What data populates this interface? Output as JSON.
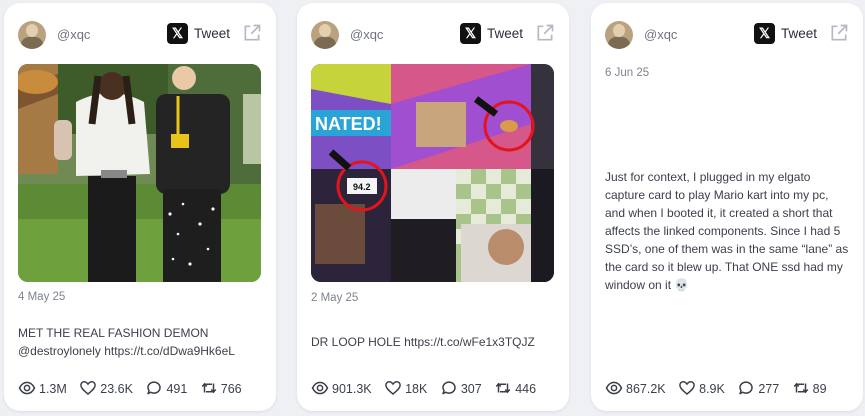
{
  "cards": [
    {
      "handle": "@xqc",
      "tweet_label": "Tweet",
      "date": "4 May 25",
      "text": "MET THE REAL FASHION DEMON @destroylonely https://t.co/dDwa9Hk6eL",
      "views": "1.3M",
      "likes": "23.6K",
      "replies": "491",
      "retweets": "766"
    },
    {
      "handle": "@xqc",
      "tweet_label": "Tweet",
      "date": "2 May 25",
      "text": "DR LOOP HOLE https://t.co/wFe1x3TQJZ",
      "media_text": {
        "banner": "NATED!",
        "score": "94.2"
      },
      "views": "901.3K",
      "likes": "18K",
      "replies": "307",
      "retweets": "446"
    },
    {
      "handle": "@xqc",
      "tweet_label": "Tweet",
      "date": "6 Jun 25",
      "text": "Just for context, I plugged in my elgato capture card to play Mario kart into my pc, and when I booted it, it created a short that affects the linked components. Since I had 5 SSD’s, one of them was in the same “lane” as the card so it blew up. That ONE ssd had my window on it 💀",
      "views": "867.2K",
      "likes": "8.9K",
      "replies": "277",
      "retweets": "89"
    }
  ],
  "icons": {
    "x_logo": "x-logo-icon",
    "external": "external-link-icon",
    "views": "eye-icon",
    "likes": "heart-icon",
    "replies": "comment-icon",
    "retweets": "retweet-icon"
  },
  "colors": {
    "background": "#eef0f4",
    "card": "#ffffff",
    "text": "#3a3f4a",
    "muted": "#7e838d"
  }
}
